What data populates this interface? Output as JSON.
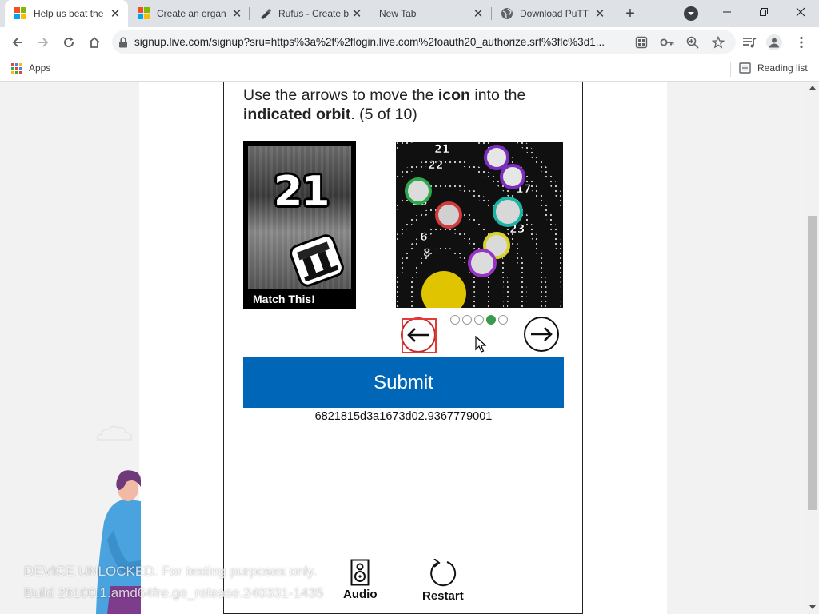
{
  "tabs": [
    {
      "title": "Help us beat the",
      "favicon": "microsoft-logo-icon",
      "active": true
    },
    {
      "title": "Create an organ",
      "favicon": "microsoft-logo-icon",
      "active": false
    },
    {
      "title": "Rufus - Create b",
      "favicon": "rufus-icon",
      "active": false
    },
    {
      "title": "New Tab",
      "favicon": "",
      "active": false
    },
    {
      "title": "Download PuTT",
      "favicon": "globe-icon",
      "active": false
    }
  ],
  "address_bar": {
    "url": "signup.live.com/signup?sru=https%3a%2f%2flogin.live.com%2foauth20_authorize.srf%3flc%3d1..."
  },
  "bookmarks": {
    "apps_label": "Apps",
    "reading_list_label": "Reading list"
  },
  "challenge": {
    "instruction_pre": "Use the arrows to move the ",
    "instruction_bold1": "icon",
    "instruction_mid": " into the",
    "instruction_bold2": "indicated orbit",
    "instruction_post": ". (5 of 10)",
    "match_number": "21",
    "match_label": "Match This!",
    "orbit_labels": [
      "21",
      "22",
      "26",
      "17",
      "6",
      "23",
      "8"
    ],
    "progress_dots_total": 5,
    "progress_dots_active_index": 3,
    "submit_label": "Submit",
    "session_id": "6821815d3a1673d02.9367779001",
    "audio_label": "Audio",
    "restart_label": "Restart"
  },
  "watermark": {
    "line1": "DEVICE UNLOCKED. For testing purposes only.",
    "line2": "Build 26100.1.amd64fre.ge_release.240331-1435"
  },
  "colors": {
    "submit_bg": "#0067b8",
    "active_dot": "#3a9a4a",
    "focus_ring": "#e53935"
  }
}
